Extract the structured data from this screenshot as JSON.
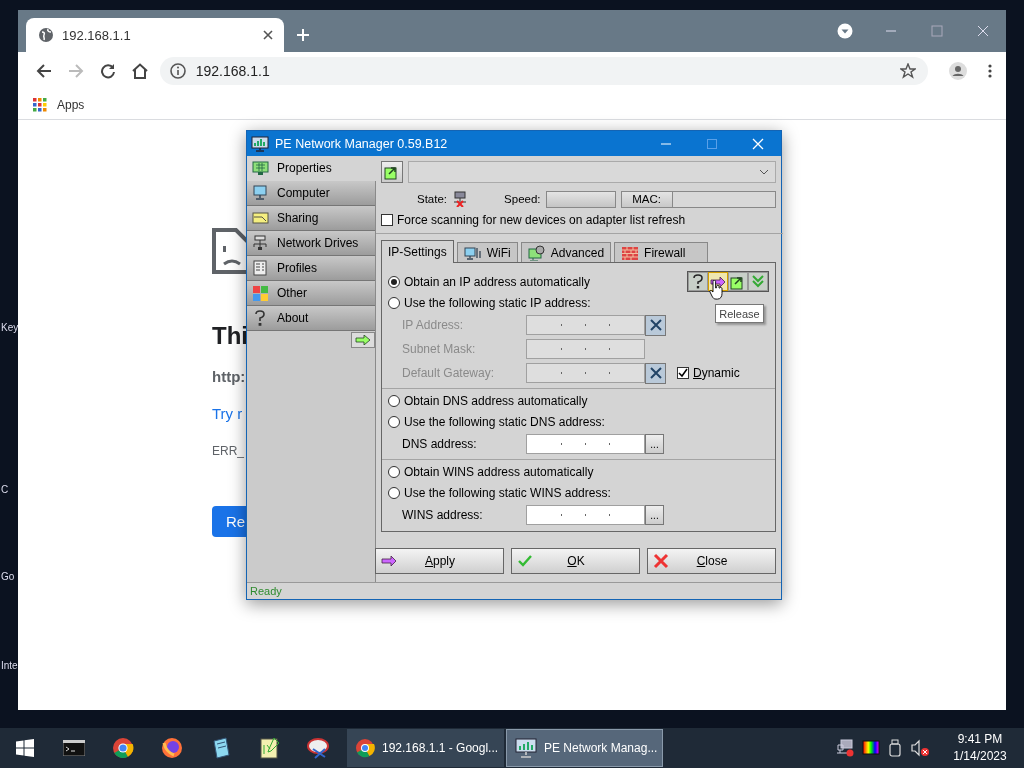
{
  "desktop_labels": [
    "Key",
    "C",
    "Go",
    "Inte"
  ],
  "browser": {
    "tab_title": "192.168.1.1",
    "address": "192.168.1.1",
    "bookmarks": [
      "Apps"
    ],
    "page": {
      "heading": "Thi",
      "url": "http:",
      "suggestion": "Try r",
      "error_code": "ERR_",
      "button": "Re"
    }
  },
  "dialog": {
    "title": "PE Network Manager 0.59.B12",
    "sidebar": [
      {
        "label": "Properties",
        "selected": true
      },
      {
        "label": "Computer",
        "selected": false
      },
      {
        "label": "Sharing",
        "selected": false
      },
      {
        "label": "Network Drives",
        "selected": false
      },
      {
        "label": "Profiles",
        "selected": false
      },
      {
        "label": "Other",
        "selected": false
      },
      {
        "label": "About",
        "selected": false
      }
    ],
    "state_label": "State:",
    "speed_label": "Speed:",
    "mac_label": "MAC:",
    "force_scan": {
      "label": "Force scanning for new devices on adapter list refresh",
      "checked": false
    },
    "tabs": [
      {
        "label": "IP-Settings",
        "selected": true
      },
      {
        "label": "WiFi",
        "selected": false
      },
      {
        "label": "Advanced",
        "selected": false
      },
      {
        "label": "Firewall",
        "selected": false
      }
    ],
    "ip_mode": [
      {
        "label": "Obtain an IP address automatically",
        "selected": true
      },
      {
        "label": "Use the following static IP address:",
        "selected": false
      }
    ],
    "ip_fields": [
      {
        "label": "IP Address:",
        "disabled": true,
        "kind": "clearable"
      },
      {
        "label": "Subnet Mask:",
        "disabled": true,
        "kind": "plain"
      },
      {
        "label": "Default Gateway:",
        "disabled": true,
        "kind": "clearable"
      }
    ],
    "dynamic": {
      "label": "Dynamic",
      "checked": true
    },
    "tooltip": "Release",
    "dns_mode": [
      {
        "label": "Obtain DNS address automatically",
        "selected": false
      },
      {
        "label": "Use the following static DNS address:",
        "selected": false
      }
    ],
    "dns_field": {
      "label": "DNS address:",
      "disabled": false,
      "button": "..."
    },
    "wins_mode": [
      {
        "label": "Obtain WINS address automatically",
        "selected": false
      },
      {
        "label": "Use the following static WINS address:",
        "selected": false
      }
    ],
    "wins_field": {
      "label": "WINS address:",
      "disabled": false,
      "button": "..."
    },
    "buttons": [
      {
        "label": "Apply"
      },
      {
        "label": "OK"
      },
      {
        "label": "Close"
      }
    ],
    "status": "Ready"
  },
  "taskbar": {
    "windows": [
      {
        "label": "192.168.1.1 - Googl...",
        "selected": false
      },
      {
        "label": "PE Network Manag...",
        "selected": true
      }
    ],
    "time": "9:41 PM",
    "date": "1/14/2023"
  }
}
